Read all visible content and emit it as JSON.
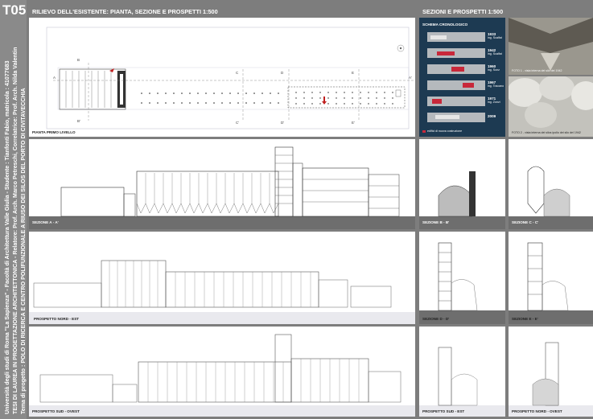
{
  "sheet": {
    "code": "T05",
    "left_title": "RILIEVO DELL'ESISTENTE: PIANTA, SEZIONE E PROSPETTI 1:500",
    "right_title": "SEZIONI E PROSPETTI 1:500",
    "side_lines": [
      "Università degli studi di Roma \"La Sapienza\" - Facoltà di Architettura Valle Giulia - Studente : Tianfonti Fabio, matricola : 41077683",
      "TESI DI LAUREA IN PROGETTAZIONE ARCHITETTONICA - Relatore: Prof. Arch. Marco Petreschi, Correlatrice: Prof. Arch. Nilda Valentin",
      "Tema di progetto : POLO DI RICERCA E CENTRO POLIFUNZIONALE A RIUSO DEI SILOS DEL PORTO DI CIVITAVECCHIA"
    ]
  },
  "plan": {
    "label": "PIANTA PRIMO LIVELLO",
    "markers": [
      "A",
      "A'",
      "B",
      "B'",
      "C",
      "C'",
      "D",
      "D'",
      "E",
      "E'"
    ]
  },
  "chrono": {
    "title": "SCHEMA CRONOLOGICO",
    "entries": [
      {
        "year": "1933",
        "note": "ing. Scalfat"
      },
      {
        "year": "1942",
        "note": "ing. Scalfat"
      },
      {
        "year": "1960",
        "note": "ing. Sonz"
      },
      {
        "year": "1967",
        "note": "ing. Toscano"
      },
      {
        "year": "1971",
        "note": "ing. Zonzi"
      },
      {
        "year": "2009",
        "note": ""
      }
    ],
    "legend": "edifici di nuova costruzione"
  },
  "photos": {
    "caption_1": "FOTO 1 - vista interna del silo del 1942",
    "caption_2": "FOTO 2 - vista interna dei silos ipollo dei silo del 1942"
  },
  "drawings": {
    "section_a": "SEZIONE A - A'",
    "section_b": "SEZIONE B - B'",
    "section_c": "SEZIONE C - C'",
    "nord_est": "PROSPETTO NORD - EST",
    "section_d": "SEZIONE D - D'",
    "section_e": "SEZIONE E - E'",
    "sud_ovest": "PROSPETTO SUD - OVEST",
    "sud_est": "PROSPETTO SUD - EST",
    "nord_ovest": "PROSPETTO NORD - OVEST"
  }
}
